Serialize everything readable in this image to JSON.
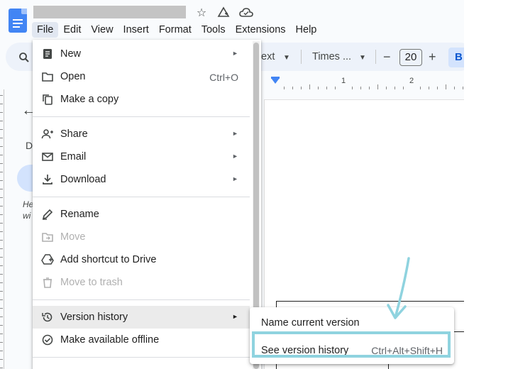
{
  "window": {
    "menubar": [
      "File",
      "Edit",
      "View",
      "Insert",
      "Format",
      "Tools",
      "Extensions",
      "Help"
    ],
    "active_menu": "File"
  },
  "toolbar": {
    "style_fragment": "ext",
    "font": "Times ...",
    "font_size": "20",
    "bold_label": "B",
    "minus": "−",
    "plus": "+"
  },
  "ruler": {
    "marks": [
      "1",
      "2"
    ]
  },
  "sidebar": {
    "back_icon": "arrow-left-icon",
    "fragment_d": "D",
    "fragment_he": "He",
    "fragment_wi": "wi"
  },
  "file_menu": {
    "groups": [
      [
        {
          "label": "New",
          "icon": "document-icon",
          "submenu": true
        },
        {
          "label": "Open",
          "icon": "folder-icon",
          "shortcut": "Ctrl+O"
        },
        {
          "label": "Make a copy",
          "icon": "copy-icon"
        }
      ],
      [
        {
          "label": "Share",
          "icon": "person-add-icon",
          "submenu": true
        },
        {
          "label": "Email",
          "icon": "mail-icon",
          "submenu": true
        },
        {
          "label": "Download",
          "icon": "download-icon",
          "submenu": true
        }
      ],
      [
        {
          "label": "Rename",
          "icon": "pencil-icon"
        },
        {
          "label": "Move",
          "icon": "folder-move-icon",
          "disabled": true
        },
        {
          "label": "Add shortcut to Drive",
          "icon": "drive-shortcut-icon"
        },
        {
          "label": "Move to trash",
          "icon": "trash-icon",
          "disabled": true
        }
      ],
      [
        {
          "label": "Version history",
          "icon": "history-icon",
          "submenu": true,
          "highlighted": true
        },
        {
          "label": "Make available offline",
          "icon": "offline-check-icon"
        }
      ]
    ]
  },
  "version_submenu": {
    "items": [
      {
        "label": "Name current version",
        "shortcut": ""
      },
      {
        "label": "See version history",
        "shortcut": "Ctrl+Alt+Shift+H"
      }
    ]
  },
  "annotation": {
    "highlight_color": "#8fd3df"
  }
}
